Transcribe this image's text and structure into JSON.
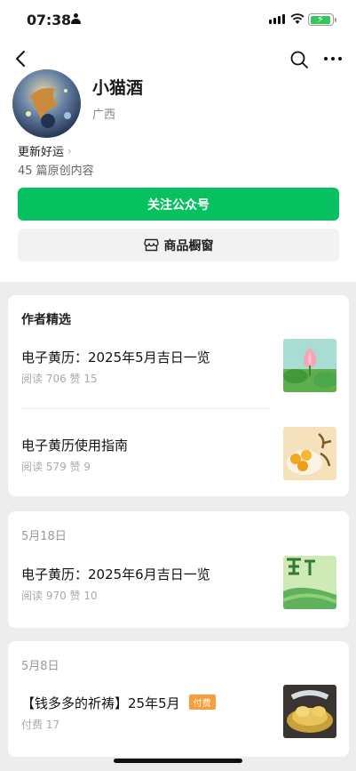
{
  "status_bar": {
    "time": "07:38"
  },
  "profile": {
    "name": "小猫酒",
    "region": "广西",
    "signature": "更新好运",
    "original_count": "45 篇原创内容"
  },
  "actions": {
    "follow_label": "关注公众号",
    "shop_label": "商品橱窗"
  },
  "featured": {
    "title": "作者精选",
    "articles": [
      {
        "title": "电子黄历：2025年5月吉日一览",
        "meta": "阅读 706  赞 15"
      },
      {
        "title": "电子黄历使用指南",
        "meta": "阅读 579  赞 9"
      }
    ]
  },
  "feed": [
    {
      "date": "5月18日",
      "title": "电子黄历：2025年6月吉日一览",
      "meta": "阅读 970  赞 10"
    },
    {
      "date": "5月8日",
      "title": "【钱多多的祈祷】25年5月",
      "badge": "付费",
      "meta": "付费 17"
    }
  ],
  "colors": {
    "accent_green": "#07c160",
    "paid_badge": "#fa9d3b"
  },
  "icons": [
    "back-icon",
    "search-icon",
    "more-icon",
    "shop-icon"
  ]
}
